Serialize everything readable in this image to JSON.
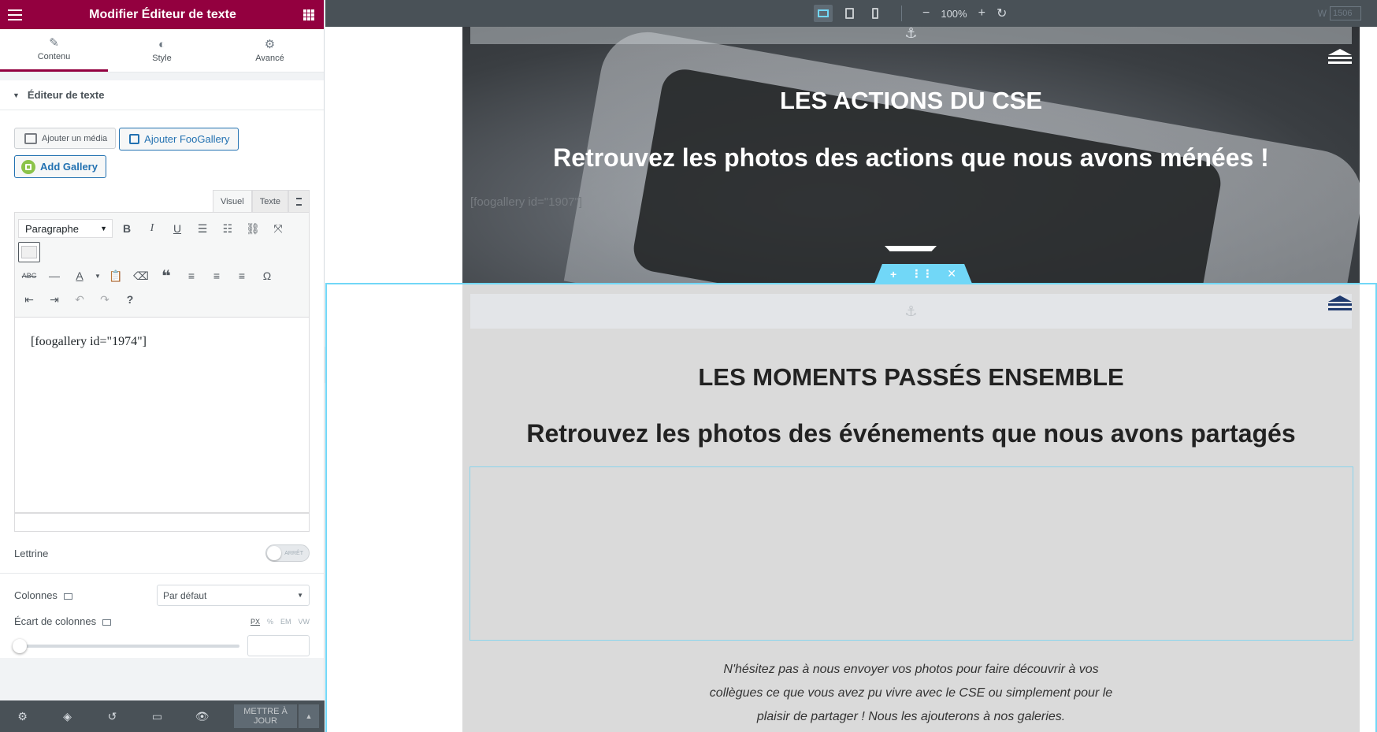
{
  "panel": {
    "title": "Modifier Éditeur de texte",
    "tabs": [
      {
        "label": "Contenu",
        "icon": "pencil-icon",
        "active": true
      },
      {
        "label": "Style",
        "icon": "half-circle-icon",
        "active": false
      },
      {
        "label": "Avancé",
        "icon": "gear-icon",
        "active": false
      }
    ],
    "section_title": "Éditeur de texte",
    "media_button": "Ajouter un média",
    "foogallery_button": "Ajouter FooGallery",
    "add_gallery_button": "Add Gallery",
    "editor_tabs": {
      "visual": "Visuel",
      "text": "Texte"
    },
    "format_select": "Paragraphe",
    "editor_content": "[foogallery id=\"1974\"]",
    "dropcap_label": "Lettrine",
    "dropcap_state": "ARRÊT",
    "columns_label": "Colonnes",
    "columns_value": "Par défaut",
    "gap_label": "Écart de colonnes",
    "units": [
      "PX",
      "%",
      "EM",
      "VW"
    ],
    "footer": {
      "update_line1": "METTRE À",
      "update_line2": "JOUR"
    }
  },
  "topbar": {
    "zoom": "100%",
    "width_label": "W",
    "width_value": "1506"
  },
  "canvas": {
    "section1": {
      "title": "LES ACTIONS DU CSE",
      "subtitle": "Retrouvez les photos des actions que nous avons ménées !",
      "shortcode": "[foogallery id=\"1907\"]"
    },
    "section2": {
      "title": "LES MOMENTS PASSÉS ENSEMBLE",
      "subtitle": "Retrouvez les photos des événements que nous avons partagés",
      "text_line1": "N'hésitez pas à nous envoyer vos photos pour faire découvrir à vos",
      "text_line2": "collègues ce que vous avez pu vivre avec le CSE ou simplement pour le",
      "text_line3": "plaisir de partager ! Nous les ajouterons à nos galeries."
    }
  },
  "colors": {
    "brand": "#93003f",
    "accent": "#71d7f7",
    "panel_dark": "#495157",
    "wp_blue": "#2271b1"
  }
}
